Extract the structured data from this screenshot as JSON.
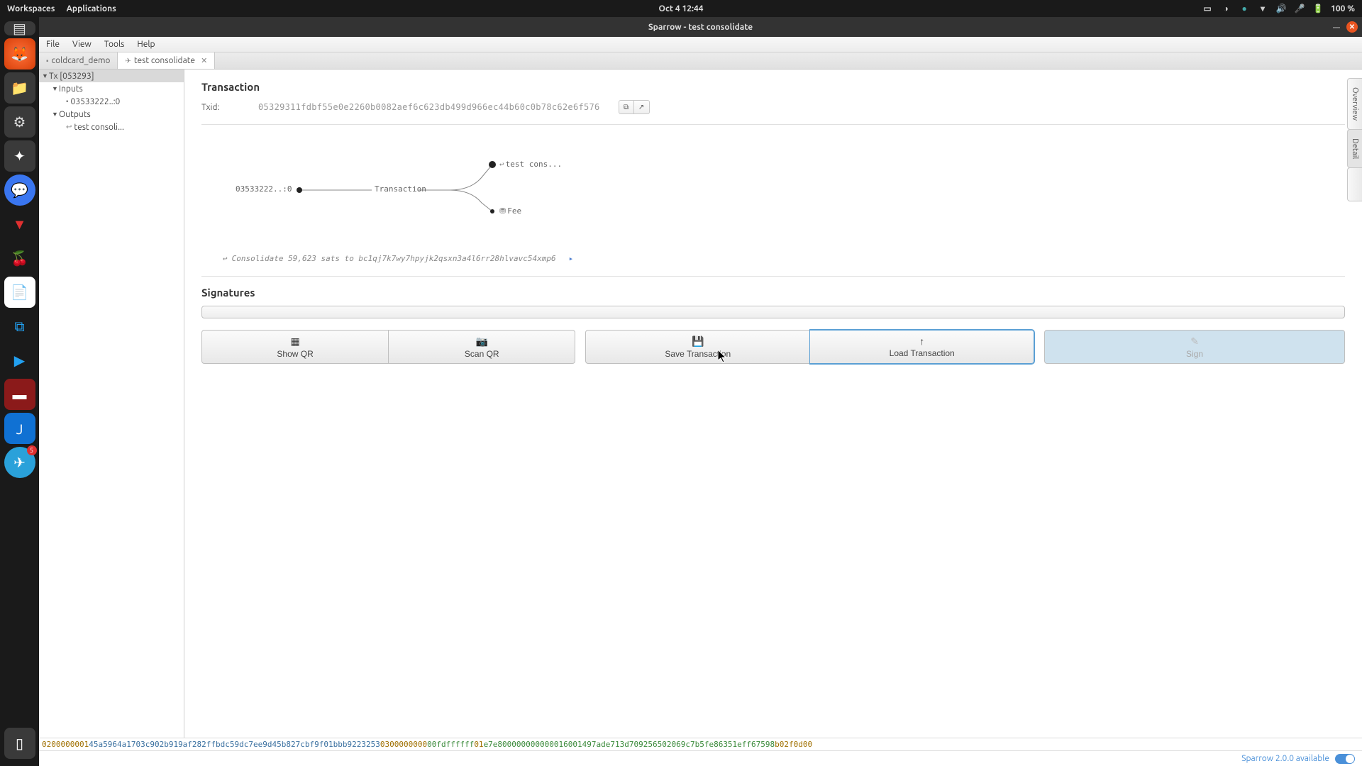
{
  "os": {
    "workspaces": "Workspaces",
    "applications": "Applications",
    "clock": "Oct 4  12:44",
    "battery": "100 %"
  },
  "window": {
    "title": "Sparrow - test consolidate"
  },
  "dock_badge": "5",
  "menubar": {
    "file": "File",
    "view": "View",
    "tools": "Tools",
    "help": "Help"
  },
  "tabs": [
    {
      "label": "coldcard_demo",
      "active": false
    },
    {
      "label": "test consolidate",
      "active": true
    }
  ],
  "tree": {
    "root": "Tx [053293]",
    "inputs": "Inputs",
    "input0": "03533222..:0",
    "outputs": "Outputs",
    "output0": "test consoli..."
  },
  "tx": {
    "section": "Transaction",
    "txid_label": "Txid:",
    "txid": "05329311fdbf55e0e2260b0082aef6c623db499d966ec44b60c0b78c62e6f576"
  },
  "diagram": {
    "input": "03533222..:0",
    "center": "Transaction",
    "out1": "test cons...",
    "out2": "Fee"
  },
  "desc": "Consolidate 59,623 sats to bc1qj7k7wy7hpyjk2qsxn3a4l6rr28hlvavc54xmp6",
  "sigs": {
    "section": "Signatures"
  },
  "buttons": {
    "show_qr": "Show QR",
    "scan_qr": "Scan QR",
    "save": "Save Transaction",
    "load": "Load Transaction",
    "sign": "Sign"
  },
  "side": {
    "overview": "Overview",
    "detail": "Detail"
  },
  "hex": {
    "p1": "0200000001",
    "p2": "45a5964a1703c902b919af282ffbdc59dc7ee9d45b827cbf9f01bbb9223253",
    "p3": "0300000000",
    "p4": "00fdffffff",
    "p5": "01",
    "p6": "e7e800000000000016001497ade713d709256502069c7b5fe86351eff67598",
    "p7": "b02f0d00"
  },
  "status": {
    "update": "Sparrow 2.0.0 available"
  }
}
